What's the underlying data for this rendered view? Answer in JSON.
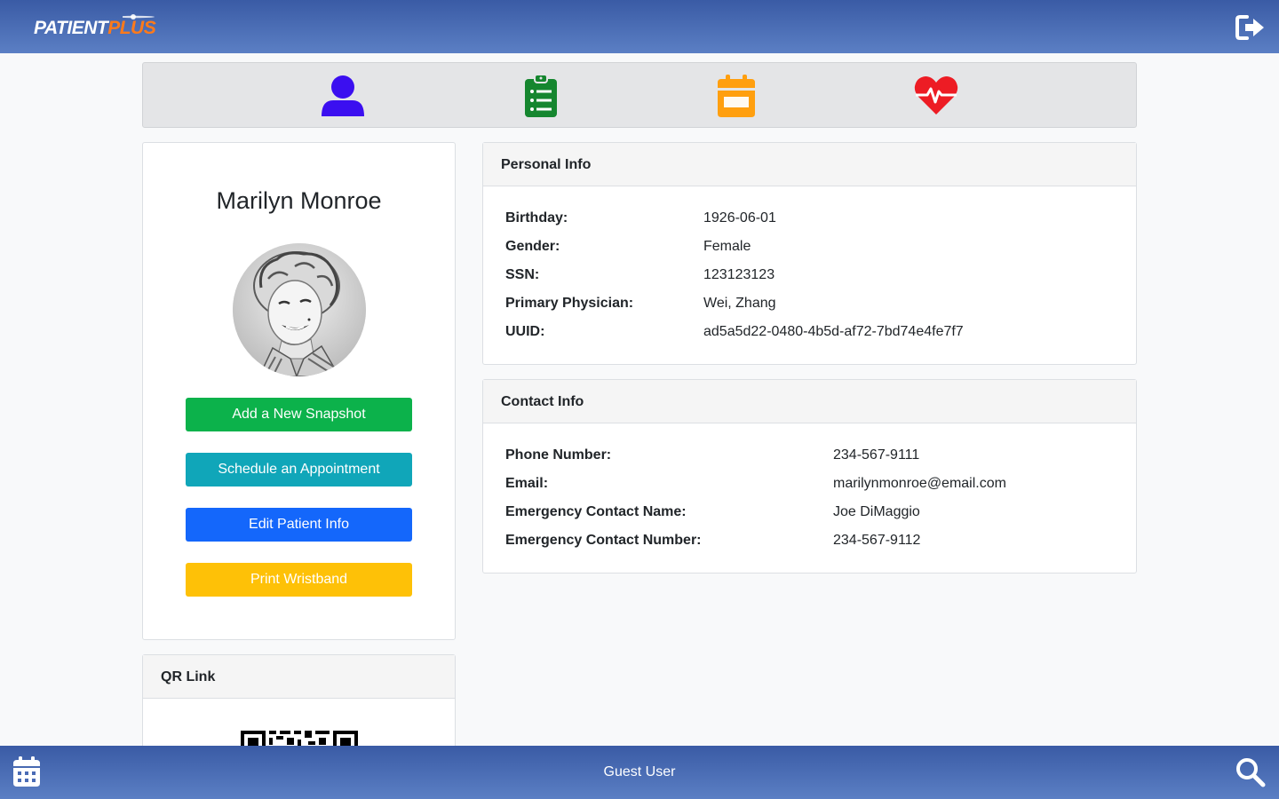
{
  "header": {
    "logo_part1": "PATIENT",
    "logo_part2": "PLUS",
    "logout_icon": "sign-out-icon"
  },
  "nav": {
    "items": [
      {
        "icon": "user-icon",
        "color": "#3b0ff0"
      },
      {
        "icon": "clipboard-list-icon",
        "color": "#15862f"
      },
      {
        "icon": "calendar-icon",
        "color": "#ff9f0f"
      },
      {
        "icon": "heartbeat-icon",
        "color": "#ed1c24"
      }
    ]
  },
  "profile": {
    "name": "Marilyn Monroe",
    "buttons": {
      "snapshot": "Add a New Snapshot",
      "appointment": "Schedule an Appointment",
      "edit": "Edit Patient Info",
      "wristband": "Print Wristband"
    }
  },
  "qr": {
    "title": "QR Link"
  },
  "personal": {
    "title": "Personal Info",
    "rows": [
      {
        "label": "Birthday:",
        "value": "1926-06-01"
      },
      {
        "label": "Gender:",
        "value": "Female"
      },
      {
        "label": "SSN:",
        "value": "123123123"
      },
      {
        "label": "Primary Physician:",
        "value": "Wei, Zhang"
      },
      {
        "label": "UUID:",
        "value": "ad5a5d22-0480-4b5d-af72-7bd74e4fe7f7"
      }
    ]
  },
  "contact": {
    "title": "Contact Info",
    "rows": [
      {
        "label": "Phone Number:",
        "value": "234-567-9111"
      },
      {
        "label": "Email:",
        "value": "marilynmonroe@email.com"
      },
      {
        "label": "Emergency Contact Name:",
        "value": "Joe DiMaggio"
      },
      {
        "label": "Emergency Contact Number:",
        "value": "234-567-9112"
      }
    ]
  },
  "footer": {
    "user": "Guest User",
    "left_icon": "calendar-icon",
    "right_icon": "search-icon"
  }
}
